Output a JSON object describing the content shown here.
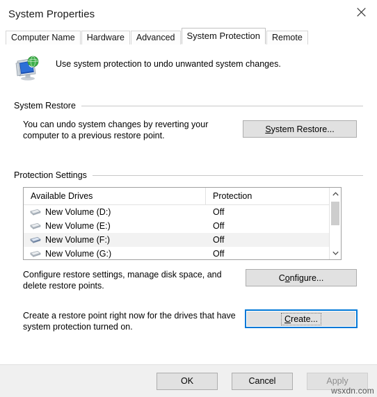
{
  "window": {
    "title": "System Properties",
    "close_icon": "close-icon"
  },
  "tabs": [
    {
      "label": "Computer Name",
      "active": false
    },
    {
      "label": "Hardware",
      "active": false
    },
    {
      "label": "Advanced",
      "active": false
    },
    {
      "label": "System Protection",
      "active": true
    },
    {
      "label": "Remote",
      "active": false
    }
  ],
  "header": {
    "icon": "system-protection-icon",
    "description": "Use system protection to undo unwanted system changes."
  },
  "system_restore": {
    "group_title": "System Restore",
    "description": "You can undo system changes by reverting your computer to a previous restore point.",
    "button_label": "System Restore...",
    "button_accelerator": "S"
  },
  "protection_settings": {
    "group_title": "Protection Settings",
    "columns": [
      "Available Drives",
      "Protection"
    ],
    "rows": [
      {
        "drive": "New Volume (D:)",
        "protection": "Off",
        "selected": false
      },
      {
        "drive": "New Volume (E:)",
        "protection": "Off",
        "selected": false
      },
      {
        "drive": "New Volume (F:)",
        "protection": "Off",
        "selected": true
      },
      {
        "drive": "New Volume (G:)",
        "protection": "Off",
        "selected": false
      }
    ],
    "scroll_up_icon": "chevron-up-icon",
    "scroll_down_icon": "chevron-down-icon",
    "configure": {
      "description": "Configure restore settings, manage disk space, and delete restore points.",
      "button_label": "Configure...",
      "button_accelerator": "o"
    },
    "create": {
      "description": "Create a restore point right now for the drives that have system protection turned on.",
      "button_label": "Create...",
      "button_accelerator": "C",
      "focused": true
    }
  },
  "footer": {
    "ok_label": "OK",
    "cancel_label": "Cancel",
    "apply_label": "Apply",
    "apply_disabled": true
  },
  "watermark": "wsxdn.com",
  "colors": {
    "accent": "#0078d7",
    "dialog_bg": "#f0f0f0",
    "panel_bg": "#ffffff",
    "button_face": "#e1e1e1",
    "button_border": "#adadad",
    "selected_row": "#f2f2f2"
  }
}
